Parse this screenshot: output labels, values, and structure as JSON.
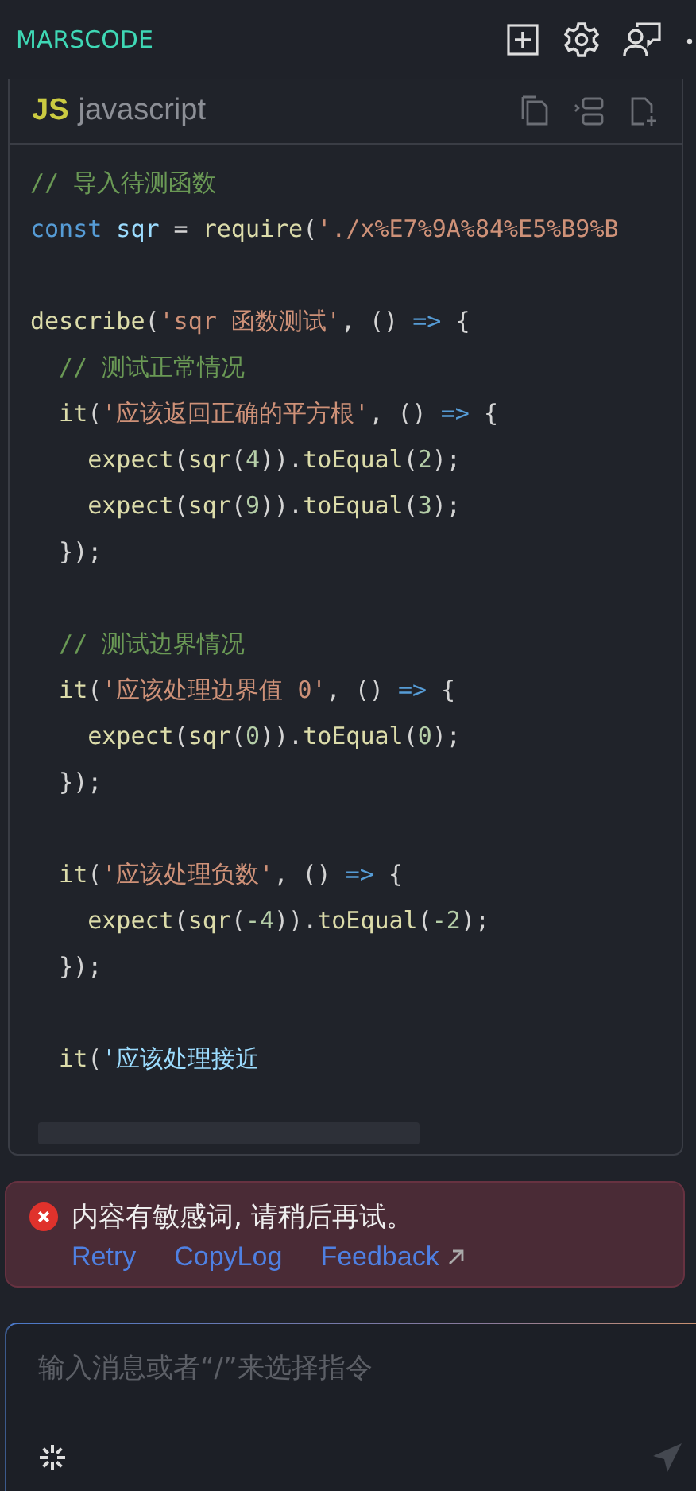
{
  "header": {
    "title": "MARSCODE"
  },
  "code_block": {
    "badge": "JS",
    "language": "javascript",
    "lines": [
      {
        "kind": "code",
        "tokens": [
          {
            "kind": "comment",
            "text": "// 导入待测函数"
          }
        ]
      },
      {
        "kind": "code",
        "tokens": [
          {
            "kind": "keyword",
            "text": "const"
          },
          {
            "kind": "variable",
            "text": " sqr"
          },
          {
            "kind": "punct",
            "text": " = "
          },
          {
            "kind": "func",
            "text": "require"
          },
          {
            "kind": "punct",
            "text": "("
          },
          {
            "kind": "string",
            "text": "'./x%E7%9A%84%E5%B9%B"
          }
        ]
      },
      {
        "kind": "blank"
      },
      {
        "kind": "code",
        "tokens": [
          {
            "kind": "func",
            "text": "describe"
          },
          {
            "kind": "punct",
            "text": "("
          },
          {
            "kind": "string",
            "text": "'sqr 函数测试'"
          },
          {
            "kind": "punct",
            "text": ", () "
          },
          {
            "kind": "keyword",
            "text": "=>"
          },
          {
            "kind": "punct",
            "text": " {"
          }
        ]
      },
      {
        "kind": "code",
        "tokens": [
          {
            "kind": "comment",
            "text": "  // 测试正常情况"
          }
        ]
      },
      {
        "kind": "code",
        "tokens": [
          {
            "kind": "func",
            "text": "  it"
          },
          {
            "kind": "punct",
            "text": "("
          },
          {
            "kind": "string",
            "text": "'应该返回正确的平方根'"
          },
          {
            "kind": "punct",
            "text": ", () "
          },
          {
            "kind": "keyword",
            "text": "=>"
          },
          {
            "kind": "punct",
            "text": " {"
          }
        ]
      },
      {
        "kind": "code",
        "tokens": [
          {
            "kind": "func",
            "text": "    expect"
          },
          {
            "kind": "punct",
            "text": "("
          },
          {
            "kind": "func",
            "text": "sqr"
          },
          {
            "kind": "punct",
            "text": "("
          },
          {
            "kind": "number",
            "text": "4"
          },
          {
            "kind": "punct",
            "text": "))."
          },
          {
            "kind": "func",
            "text": "toEqual"
          },
          {
            "kind": "punct",
            "text": "("
          },
          {
            "kind": "number",
            "text": "2"
          },
          {
            "kind": "punct",
            "text": ");"
          }
        ]
      },
      {
        "kind": "code",
        "tokens": [
          {
            "kind": "func",
            "text": "    expect"
          },
          {
            "kind": "punct",
            "text": "("
          },
          {
            "kind": "func",
            "text": "sqr"
          },
          {
            "kind": "punct",
            "text": "("
          },
          {
            "kind": "number",
            "text": "9"
          },
          {
            "kind": "punct",
            "text": "))."
          },
          {
            "kind": "func",
            "text": "toEqual"
          },
          {
            "kind": "punct",
            "text": "("
          },
          {
            "kind": "number",
            "text": "3"
          },
          {
            "kind": "punct",
            "text": ");"
          }
        ]
      },
      {
        "kind": "code",
        "tokens": [
          {
            "kind": "punct",
            "text": "  });"
          }
        ]
      },
      {
        "kind": "blank"
      },
      {
        "kind": "code",
        "tokens": [
          {
            "kind": "comment",
            "text": "  // 测试边界情况"
          }
        ]
      },
      {
        "kind": "code",
        "tokens": [
          {
            "kind": "func",
            "text": "  it"
          },
          {
            "kind": "punct",
            "text": "("
          },
          {
            "kind": "string",
            "text": "'应该处理边界值 0'"
          },
          {
            "kind": "punct",
            "text": ", () "
          },
          {
            "kind": "keyword",
            "text": "=>"
          },
          {
            "kind": "punct",
            "text": " {"
          }
        ]
      },
      {
        "kind": "code",
        "tokens": [
          {
            "kind": "func",
            "text": "    expect"
          },
          {
            "kind": "punct",
            "text": "("
          },
          {
            "kind": "func",
            "text": "sqr"
          },
          {
            "kind": "punct",
            "text": "("
          },
          {
            "kind": "number",
            "text": "0"
          },
          {
            "kind": "punct",
            "text": "))."
          },
          {
            "kind": "func",
            "text": "toEqual"
          },
          {
            "kind": "punct",
            "text": "("
          },
          {
            "kind": "number",
            "text": "0"
          },
          {
            "kind": "punct",
            "text": ");"
          }
        ]
      },
      {
        "kind": "code",
        "tokens": [
          {
            "kind": "punct",
            "text": "  });"
          }
        ]
      },
      {
        "kind": "blank"
      },
      {
        "kind": "code",
        "tokens": [
          {
            "kind": "func",
            "text": "  it"
          },
          {
            "kind": "punct",
            "text": "("
          },
          {
            "kind": "string",
            "text": "'应该处理负数'"
          },
          {
            "kind": "punct",
            "text": ", () "
          },
          {
            "kind": "keyword",
            "text": "=>"
          },
          {
            "kind": "punct",
            "text": " {"
          }
        ]
      },
      {
        "kind": "code",
        "tokens": [
          {
            "kind": "func",
            "text": "    expect"
          },
          {
            "kind": "punct",
            "text": "("
          },
          {
            "kind": "func",
            "text": "sqr"
          },
          {
            "kind": "punct",
            "text": "("
          },
          {
            "kind": "number",
            "text": "-4"
          },
          {
            "kind": "punct",
            "text": "))."
          },
          {
            "kind": "func",
            "text": "toEqual"
          },
          {
            "kind": "punct",
            "text": "("
          },
          {
            "kind": "number",
            "text": "-2"
          },
          {
            "kind": "punct",
            "text": ");"
          }
        ]
      },
      {
        "kind": "code",
        "tokens": [
          {
            "kind": "punct",
            "text": "  });"
          }
        ]
      },
      {
        "kind": "blank"
      },
      {
        "kind": "code",
        "tokens": [
          {
            "kind": "func",
            "text": "  it"
          },
          {
            "kind": "punct",
            "text": "("
          },
          {
            "kind": "pending",
            "text": "'应该处理接近"
          }
        ]
      }
    ]
  },
  "error": {
    "message": "内容有敏感词, 请稍后再试。",
    "actions": [
      {
        "label": "Retry",
        "external": false
      },
      {
        "label": "CopyLog",
        "external": false
      },
      {
        "label": "Feedback",
        "external": true
      }
    ]
  },
  "input": {
    "placeholder": "输入消息或者“/”来选择指令"
  }
}
